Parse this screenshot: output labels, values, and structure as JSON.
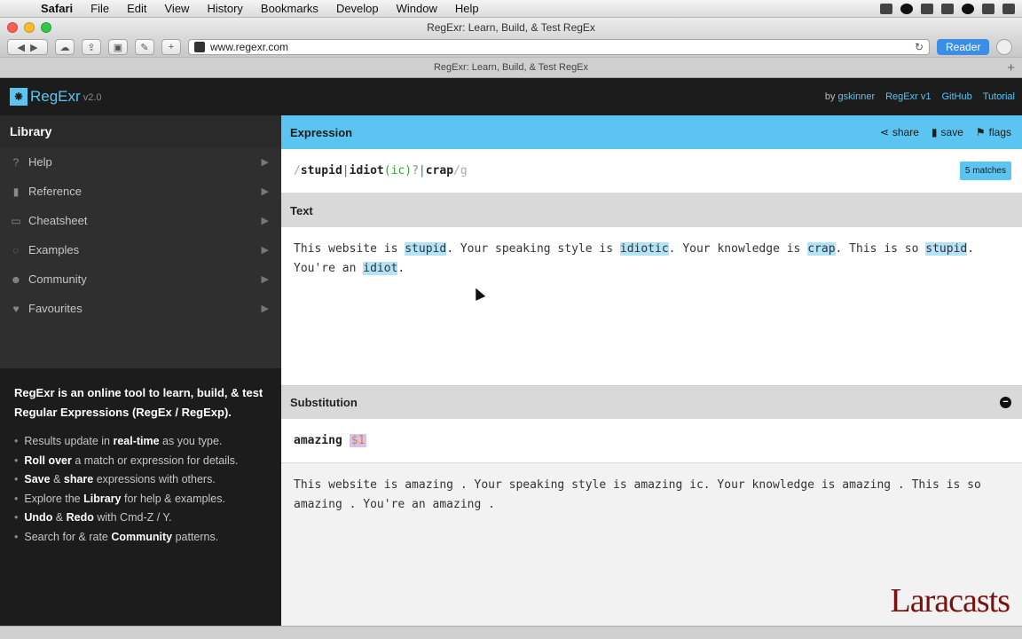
{
  "menubar": {
    "apple": "",
    "items": [
      "Safari",
      "File",
      "Edit",
      "View",
      "History",
      "Bookmarks",
      "Develop",
      "Window",
      "Help"
    ]
  },
  "window": {
    "title": "RegExr: Learn, Build, & Test RegEx",
    "tab_title": "RegExr: Learn, Build, & Test RegEx",
    "url": "www.regexr.com",
    "reader_label": "Reader",
    "new_tab_glyph": "+"
  },
  "site": {
    "logo_mark": "⁕",
    "logo_text": "RegExr",
    "logo_version": "v2.0",
    "nav": {
      "by_prefix": "by",
      "author": "gskinner",
      "links": [
        "RegExr v1",
        "GitHub",
        "Tutorial"
      ]
    }
  },
  "sidebar": {
    "heading": "Library",
    "items": [
      {
        "label": "Help",
        "icon": "?"
      },
      {
        "label": "Reference",
        "icon": "▮"
      },
      {
        "label": "Cheatsheet",
        "icon": "▭"
      },
      {
        "label": "Examples",
        "icon": "◌"
      },
      {
        "label": "Community",
        "icon": "☻"
      },
      {
        "label": "Favourites",
        "icon": "♥"
      }
    ],
    "intro_title": "RegExr is an online tool to learn, build, & test Regular Expressions (RegEx / RegExp).",
    "tips": [
      {
        "pre": "Results update in ",
        "bold": "real-time",
        "post": " as you type."
      },
      {
        "pre": "",
        "bold": "Roll over",
        "post": " a match or expression for details."
      },
      {
        "pre": "",
        "bold": "Save",
        "mid": " & ",
        "bold2": "share",
        "post": " expressions with others."
      },
      {
        "pre": "Explore the ",
        "bold": "Library",
        "post": " for help & examples."
      },
      {
        "pre": "",
        "bold": "Undo",
        "mid": " & ",
        "bold2": "Redo",
        "post": " with Cmd-Z / Y."
      },
      {
        "pre": "Search for & rate ",
        "bold": "Community",
        "post": " patterns."
      }
    ]
  },
  "expression": {
    "heading": "Expression",
    "share_label": "share",
    "save_label": "save",
    "flags_label": "flags",
    "slash_open": "/",
    "lit1": "stupid",
    "pipe1": "|",
    "lit2": "idiot",
    "group": "(ic)",
    "quant": "?",
    "pipe2": "|",
    "lit3": "crap",
    "slash_close": "/",
    "flag": "g",
    "matches_label": "5 matches"
  },
  "text": {
    "heading": "Text",
    "segments": [
      {
        "t": "This website is ",
        "m": false
      },
      {
        "t": "stupid",
        "m": true
      },
      {
        "t": ". Your speaking style is ",
        "m": false
      },
      {
        "t": "idiotic",
        "m": true
      },
      {
        "t": ". Your knowledge is ",
        "m": false
      },
      {
        "t": "crap",
        "m": true
      },
      {
        "t": ". This is so ",
        "m": false
      },
      {
        "t": "stupid",
        "m": true
      },
      {
        "t": ". You're an ",
        "m": false
      },
      {
        "t": "idiot",
        "m": true
      },
      {
        "t": ".",
        "m": false
      }
    ]
  },
  "substitution": {
    "heading": "Substitution",
    "collapse_glyph": "−",
    "replace_text": "amazing",
    "replace_var": "$1",
    "result": "This website is amazing . Your speaking style is amazing ic. Your knowledge is amazing . This is so amazing . You're an amazing ."
  },
  "watermark": "Laracasts",
  "colors": {
    "accent": "#5bc4f0",
    "match_highlight": "#b3e3f8"
  }
}
